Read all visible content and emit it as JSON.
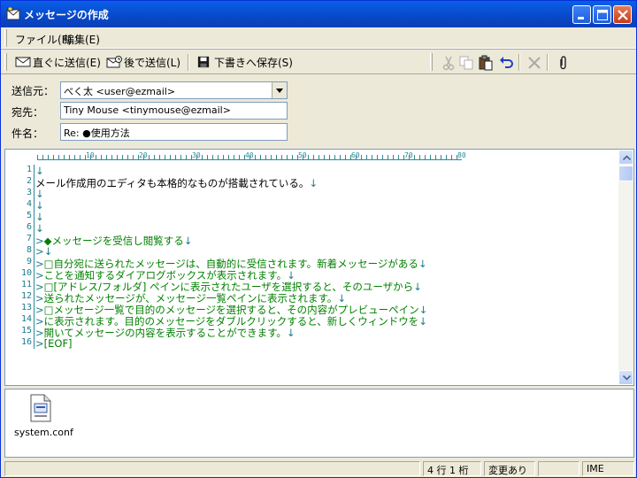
{
  "window": {
    "title": "メッセージの作成"
  },
  "menu": {
    "items": [
      {
        "label": "ファイル(F)"
      },
      {
        "label": "編集(E)"
      }
    ]
  },
  "toolbar": {
    "send_now": "直ぐに送信(E)",
    "send_later": "後で送信(L)",
    "save_draft": "下書きへ保存(S)"
  },
  "fields": {
    "from_label": "送信元：",
    "from_value": "べく太 <user@ezmail>",
    "to_label": "宛先：",
    "to_value": "Tiny Mouse <tinymouse@ezmail>",
    "subject_label": "件名：",
    "subject_value": "Re: ●使用方法"
  },
  "ruler": {
    "marks": [
      "10",
      "20",
      "30",
      "40",
      "50",
      "60",
      "70",
      "80"
    ]
  },
  "editor": {
    "lines": [
      {
        "num": "1",
        "text": "",
        "eol": "↓",
        "quote": false
      },
      {
        "num": "2",
        "text": "メール作成用のエディタも本格的なものが搭載されている。",
        "eol": "↓",
        "quote": false
      },
      {
        "num": "3",
        "text": "",
        "eol": "↓",
        "quote": false
      },
      {
        "num": "4",
        "text": "",
        "eol": "↓",
        "quote": false
      },
      {
        "num": "5",
        "text": "",
        "eol": "↓",
        "quote": false
      },
      {
        "num": "6",
        "text": "",
        "eol": "↓",
        "quote": false
      },
      {
        "num": "7",
        "text": "◆メッセージを受信し閲覧する",
        "eol": "↓",
        "quote": true
      },
      {
        "num": "8",
        "text": "",
        "eol": "↓",
        "quote": true
      },
      {
        "num": "9",
        "text": "□自分宛に送られたメッセージは、自動的に受信されます。新着メッセージがある",
        "eol": "↓",
        "quote": true
      },
      {
        "num": "10",
        "text": "ことを通知するダイアログボックスが表示されます。",
        "eol": "↓",
        "quote": true
      },
      {
        "num": "11",
        "text": "□[アドレス/フォルダ] ペインに表示されたユーザを選択すると、そのユーザから",
        "eol": "↓",
        "quote": true
      },
      {
        "num": "12",
        "text": "送られたメッセージが、メッセージ一覧ペインに表示されます。",
        "eol": "↓",
        "quote": true
      },
      {
        "num": "13",
        "text": "□メッセージ一覧で目的のメッセージを選択すると、その内容がプレビューペイン",
        "eol": "↓",
        "quote": true
      },
      {
        "num": "14",
        "text": "に表示されます。目的のメッセージをダブルクリックすると、新しくウィンドウを",
        "eol": "↓",
        "quote": true
      },
      {
        "num": "15",
        "text": "開いてメッセージの内容を表示することができます。",
        "eol": "↓",
        "quote": true
      },
      {
        "num": "16",
        "text": "[EOF]",
        "eol": "",
        "quote": true
      }
    ]
  },
  "attachment": {
    "filename": "system.conf"
  },
  "status": {
    "position": "4 行 1 桁",
    "modified": "変更あり",
    "ime": "IME"
  }
}
